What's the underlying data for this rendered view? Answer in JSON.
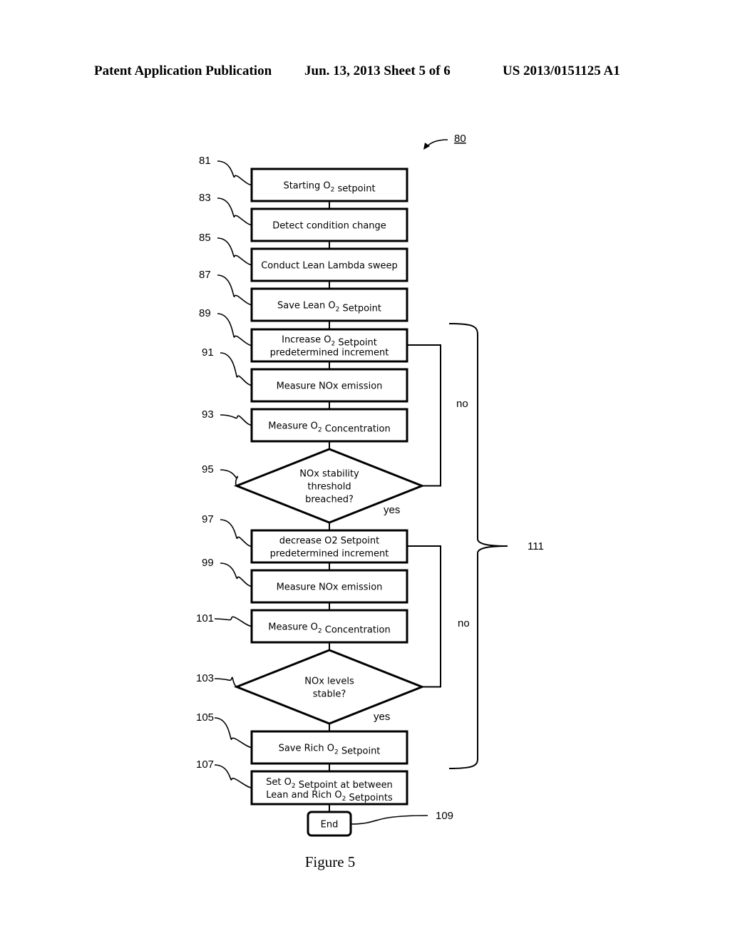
{
  "header": {
    "publication": "Patent Application Publication",
    "date_sheet": "Jun. 13, 2013  Sheet 5 of 6",
    "number": "US 2013/0151125 A1"
  },
  "diagram": {
    "figure_ref": "80",
    "brace_ref": "111",
    "caption": "Figure 5",
    "steps": [
      {
        "ref": "81",
        "lines": [
          "Starting O₂ setpoint"
        ]
      },
      {
        "ref": "83",
        "lines": [
          "Detect condition change"
        ]
      },
      {
        "ref": "85",
        "lines": [
          "Conduct Lean Lambda sweep"
        ]
      },
      {
        "ref": "87",
        "lines": [
          "Save Lean O₂ Setpoint"
        ]
      },
      {
        "ref": "89",
        "lines": [
          "Increase O₂ Setpoint",
          "predetermined increment"
        ]
      },
      {
        "ref": "91",
        "lines": [
          "Measure NOx emission"
        ]
      },
      {
        "ref": "93",
        "lines": [
          "Measure O₂ Concentration"
        ]
      },
      {
        "ref": "95",
        "lines": [
          "NOx stability",
          "threshold",
          "breached?"
        ],
        "yes": "yes",
        "no": "no"
      },
      {
        "ref": "97",
        "lines": [
          "decrease  O2 Setpoint",
          "predetermined increment"
        ]
      },
      {
        "ref": "99",
        "lines": [
          "Measure NOx emission"
        ]
      },
      {
        "ref": "101",
        "lines": [
          "Measure O₂ Concentration"
        ]
      },
      {
        "ref": "103",
        "lines": [
          "NOx levels",
          "stable?"
        ],
        "yes": "yes",
        "no": "no"
      },
      {
        "ref": "105",
        "lines": [
          "Save Rich O₂ Setpoint"
        ]
      },
      {
        "ref": "107",
        "lines": [
          "Set O₂ Setpoint at between",
          "Lean and Rich O₂ Setpoints"
        ]
      },
      {
        "ref": "109",
        "lines": [
          "End"
        ]
      }
    ]
  }
}
